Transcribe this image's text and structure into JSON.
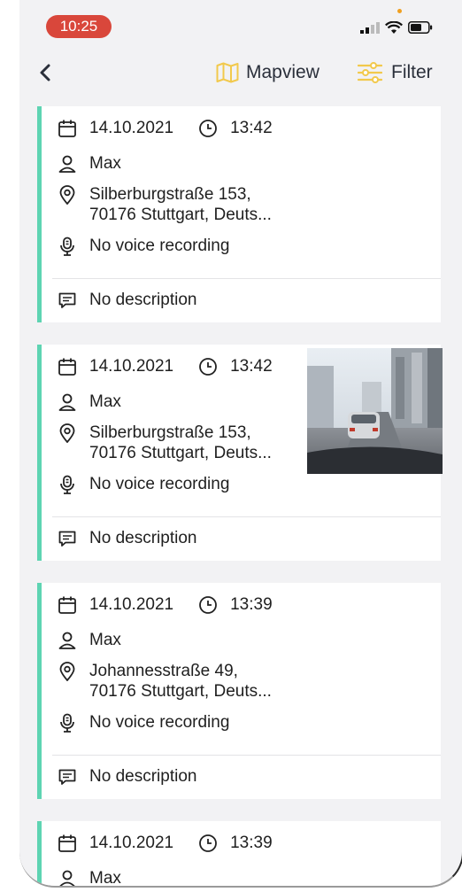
{
  "status": {
    "time": "10:25"
  },
  "nav": {
    "mapview_label": "Mapview",
    "filter_label": "Filter"
  },
  "colors": {
    "accent": "#5ed4b2",
    "icon_yellow": "#f2c94c",
    "time_pill": "#d9473b"
  },
  "entries": [
    {
      "date": "14.10.2021",
      "time": "13:42",
      "user": "Max",
      "address_line1": "Silberburgstraße 153,",
      "address_line2": "70176 Stuttgart, Deuts...",
      "voice": "No voice recording",
      "description": "No description",
      "has_photo": false
    },
    {
      "date": "14.10.2021",
      "time": "13:42",
      "user": "Max",
      "address_line1": "Silberburgstraße 153,",
      "address_line2": "70176 Stuttgart, Deuts...",
      "voice": "No voice recording",
      "description": "No description",
      "has_photo": true
    },
    {
      "date": "14.10.2021",
      "time": "13:39",
      "user": "Max",
      "address_line1": "Johannesstraße 49,",
      "address_line2": "70176 Stuttgart, Deuts...",
      "voice": "No voice recording",
      "description": "No description",
      "has_photo": false
    },
    {
      "date": "14.10.2021",
      "time": "13:39",
      "user": "Max"
    }
  ]
}
